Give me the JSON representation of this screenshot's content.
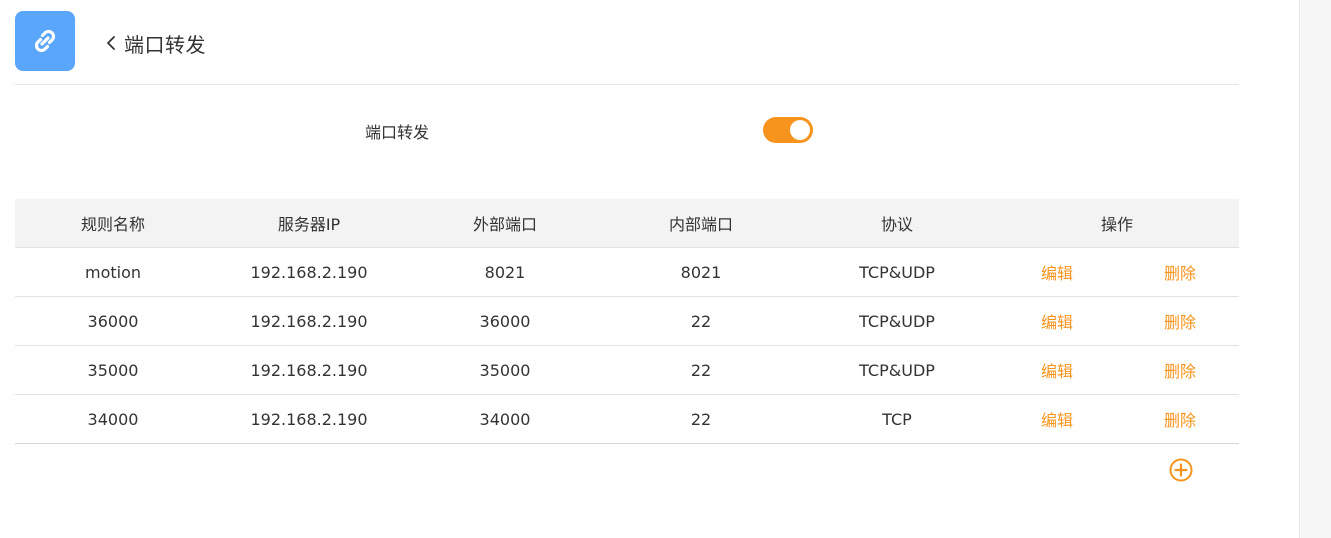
{
  "header": {
    "title": "端口转发",
    "accent_color": "#5aa6fb",
    "app_icon": "link-icon",
    "back_icon": "chevron-left-icon"
  },
  "toggle": {
    "label": "端口转发",
    "enabled": true,
    "color": "#f7941d"
  },
  "table": {
    "columns": [
      "规则名称",
      "服务器IP",
      "外部端口",
      "内部端口",
      "协议",
      "操作"
    ],
    "rows": [
      {
        "name": "motion",
        "ip": "192.168.2.190",
        "external": "8021",
        "internal": "8021",
        "protocol": "TCP&UDP",
        "edit": "编辑",
        "delete": "删除"
      },
      {
        "name": "36000",
        "ip": "192.168.2.190",
        "external": "36000",
        "internal": "22",
        "protocol": "TCP&UDP",
        "edit": "编辑",
        "delete": "删除"
      },
      {
        "name": "35000",
        "ip": "192.168.2.190",
        "external": "35000",
        "internal": "22",
        "protocol": "TCP&UDP",
        "edit": "编辑",
        "delete": "删除"
      },
      {
        "name": "34000",
        "ip": "192.168.2.190",
        "external": "34000",
        "internal": "22",
        "protocol": "TCP",
        "edit": "编辑",
        "delete": "删除"
      }
    ]
  },
  "actions": {
    "add_icon": "plus-circle-icon",
    "accent_color": "#f7941d"
  }
}
